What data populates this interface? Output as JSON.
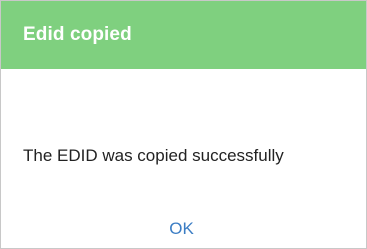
{
  "dialog": {
    "title": "Edid copied",
    "message": "The EDID was copied successfully",
    "ok_label": "OK"
  },
  "colors": {
    "header_bg": "#7fd07f",
    "header_text": "#ffffff",
    "link": "#3b7dc4",
    "body_text": "#222222"
  }
}
